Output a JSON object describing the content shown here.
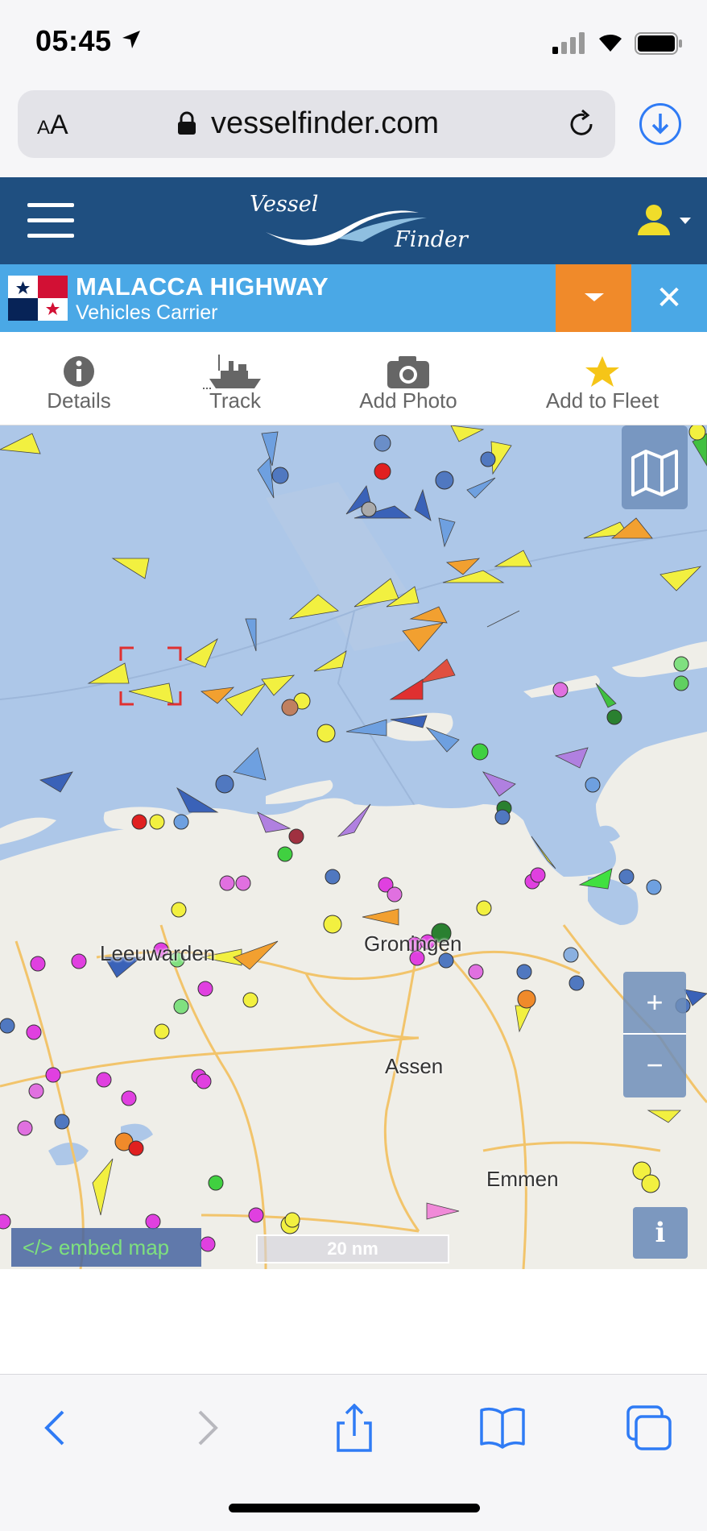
{
  "status_bar": {
    "time": "05:45"
  },
  "browser": {
    "aa_label": "AA",
    "url": "vesselfinder.com"
  },
  "header": {
    "logo_top": "Vessel",
    "logo_bottom": "Finder"
  },
  "vessel": {
    "name": "MALACCA HIGHWAY",
    "type": "Vehicles Carrier",
    "flag": "panama-flag"
  },
  "actions": [
    {
      "label": "Details",
      "icon": "info-icon"
    },
    {
      "label": "Track",
      "icon": "ship-icon"
    },
    {
      "label": "Add Photo",
      "icon": "camera-icon"
    },
    {
      "label": "Add to Fleet",
      "icon": "star-icon"
    }
  ],
  "map": {
    "places": [
      "Leeuwarden",
      "Groningen",
      "Assen",
      "Emmen"
    ],
    "zoom_in": "+",
    "zoom_out": "−",
    "info": "i",
    "embed_label": "</> embed map",
    "scale": "20 nm"
  },
  "colors": {
    "header": "#1f4f80",
    "banner": "#4aa8e6",
    "accent": "#f08a2a",
    "ios_blue": "#2f7bf5",
    "sea": "#adc7e8",
    "land": "#efeee8"
  }
}
